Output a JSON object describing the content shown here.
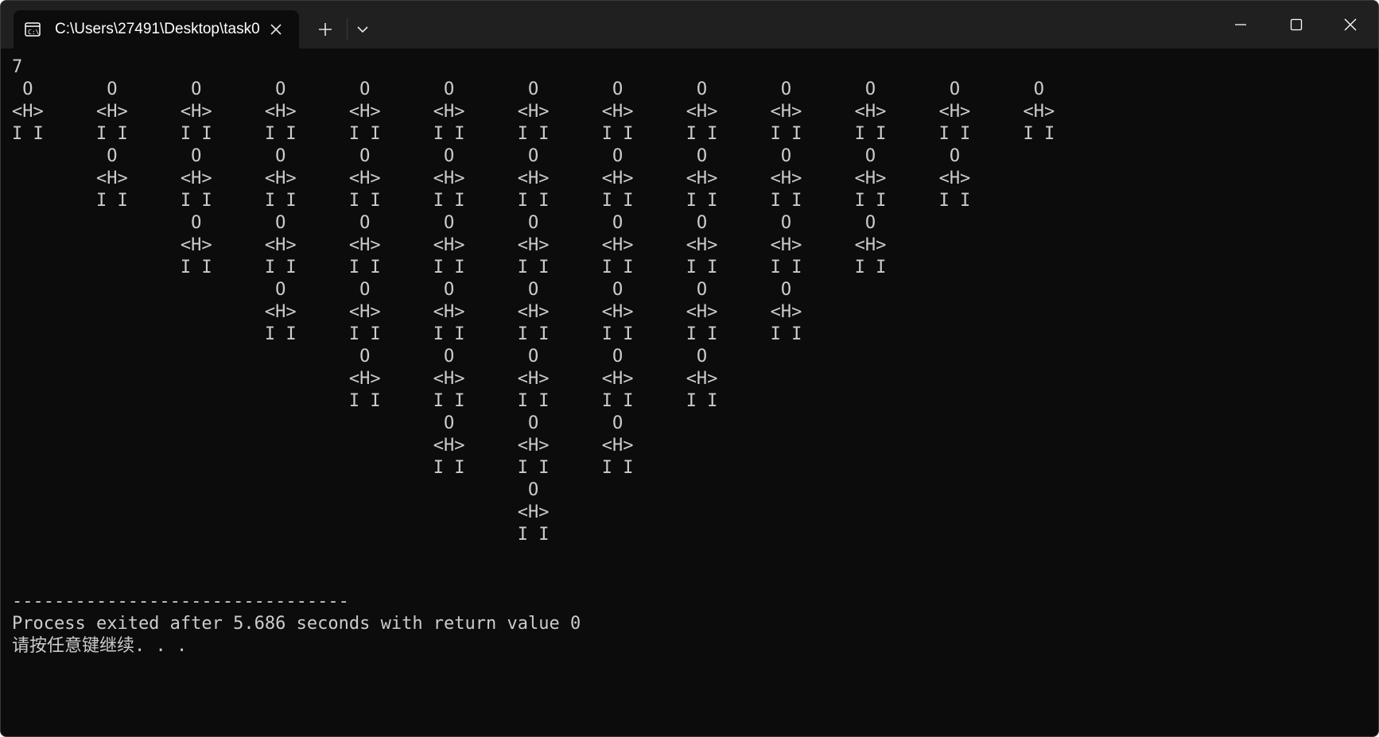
{
  "titlebar": {
    "tab_title": "C:\\Users\\27491\\Desktop\\task0",
    "icon": "console-icon",
    "close_icon": "close-icon",
    "new_tab_icon": "plus-icon",
    "dropdown_icon": "chevron-down-icon"
  },
  "window_controls": {
    "minimize_icon": "minimize-icon",
    "maximize_icon": "maximize-icon",
    "close_icon": "close-icon"
  },
  "console": {
    "output": "7\n O       O       O       O       O       O       O       O       O       O       O       O       O\n<H>     <H>     <H>     <H>     <H>     <H>     <H>     <H>     <H>     <H>     <H>     <H>     <H>\nI I     I I     I I     I I     I I     I I     I I     I I     I I     I I     I I     I I     I I\n         O       O       O       O       O       O       O       O       O       O       O\n        <H>     <H>     <H>     <H>     <H>     <H>     <H>     <H>     <H>     <H>     <H>\n        I I     I I     I I     I I     I I     I I     I I     I I     I I     I I     I I\n                 O       O       O       O       O       O       O       O       O\n                <H>     <H>     <H>     <H>     <H>     <H>     <H>     <H>     <H>\n                I I     I I     I I     I I     I I     I I     I I     I I     I I\n                         O       O       O       O       O       O       O\n                        <H>     <H>     <H>     <H>     <H>     <H>     <H>\n                        I I     I I     I I     I I     I I     I I     I I\n                                 O       O       O       O       O\n                                <H>     <H>     <H>     <H>     <H>\n                                I I     I I     I I     I I     I I\n                                         O       O       O\n                                        <H>     <H>     <H>\n                                        I I     I I     I I\n                                                 O\n                                                <H>\n                                                I I\n\n\n--------------------------------\nProcess exited after 5.686 seconds with return value 0\n请按任意键继续. . ."
  },
  "colors": {
    "terminal_bg": "#0c0c0c",
    "terminal_fg": "#cccccc",
    "titlebar_bg": "#202020"
  }
}
